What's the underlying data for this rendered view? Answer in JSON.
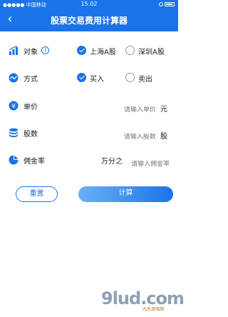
{
  "status_bar": {
    "carrier": "●●●●● 中国移动",
    "time": "15:02"
  },
  "nav": {
    "title": "股票交易费用计算器"
  },
  "rows": {
    "target": {
      "label": "对象",
      "info_icon": "info-icon",
      "option_a": "上海A股",
      "option_b": "深圳A股",
      "selected": "上海A股"
    },
    "mode": {
      "label": "方式",
      "option_a": "买入",
      "option_b": "卖出",
      "selected": "买入"
    },
    "price": {
      "label": "单价",
      "placeholder": "请输入单价",
      "unit": "元"
    },
    "shares": {
      "label": "股数",
      "placeholder": "请输入股数",
      "unit": "股"
    },
    "commission": {
      "label": "佣金率",
      "prefix": "万分之",
      "placeholder": "请输入佣金率"
    }
  },
  "buttons": {
    "reset": "重置",
    "calculate": "计算"
  },
  "watermark": {
    "text": "9lud.com",
    "sub": "九乐游戏网"
  },
  "colors": {
    "primary": "#1a73e8",
    "gradient_start": "#6ab0f5"
  }
}
